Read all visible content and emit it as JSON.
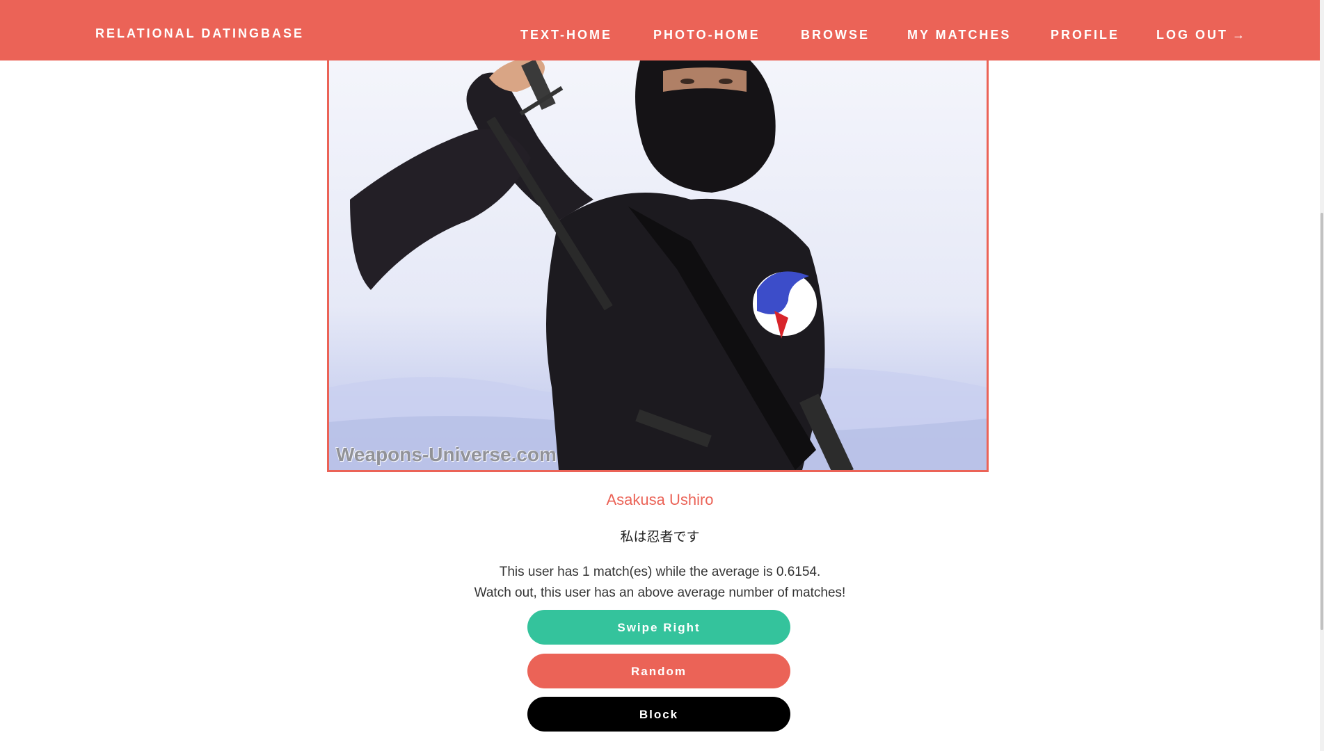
{
  "navbar": {
    "brand": "RELATIONAL DATINGBASE",
    "links": {
      "text_home": "TEXT-HOME",
      "photo_home": "PHOTO-HOME",
      "browse": "BROWSE",
      "my_matches": "MY MATCHES",
      "profile": "PROFILE",
      "log_out": "LOG OUT",
      "log_out_arrow": "→"
    }
  },
  "profile": {
    "photo_watermark": "Weapons-Universe.com",
    "name": "Asakusa Ushiro",
    "bio": "私は忍者です",
    "match_line_1": "This user has 1 match(es) while the average is 0.6154.",
    "match_line_2": "Watch out, this user has an above average number of matches!"
  },
  "actions": {
    "swipe_right": "Swipe Right",
    "random": "Random",
    "block": "Block"
  },
  "colors": {
    "accent": "#eb6357",
    "swipe": "#34c39c",
    "block": "#000000"
  }
}
